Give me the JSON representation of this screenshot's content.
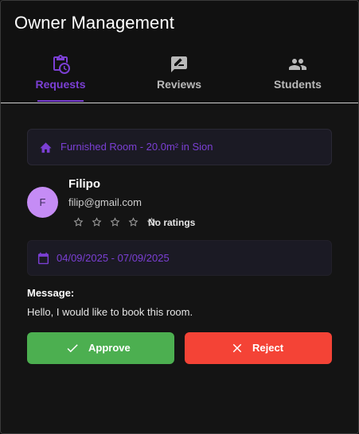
{
  "app": {
    "title": "Owner Management"
  },
  "tabs": [
    {
      "label": "Requests",
      "icon": "clipboard-clock-icon",
      "active": true
    },
    {
      "label": "Reviews",
      "icon": "rate-review-icon",
      "active": false
    },
    {
      "label": "Students",
      "icon": "people-icon",
      "active": false
    }
  ],
  "colors": {
    "accent": "#7b3fd4",
    "approve": "#4caf50",
    "reject": "#f44336",
    "avatar": "#c58cf5",
    "background": "#141414"
  },
  "request": {
    "room": "Furnished Room - 20.0m² in Sion",
    "user": {
      "initial": "F",
      "name": "Filipo",
      "email": "filip@gmail.com",
      "rating_stars": 0,
      "rating_text": "No ratings"
    },
    "dates": "04/09/2025 - 07/09/2025",
    "message_label": "Message:",
    "message": "Hello, I would like to book this room."
  },
  "actions": {
    "approve_label": "Approve",
    "reject_label": "Reject"
  }
}
